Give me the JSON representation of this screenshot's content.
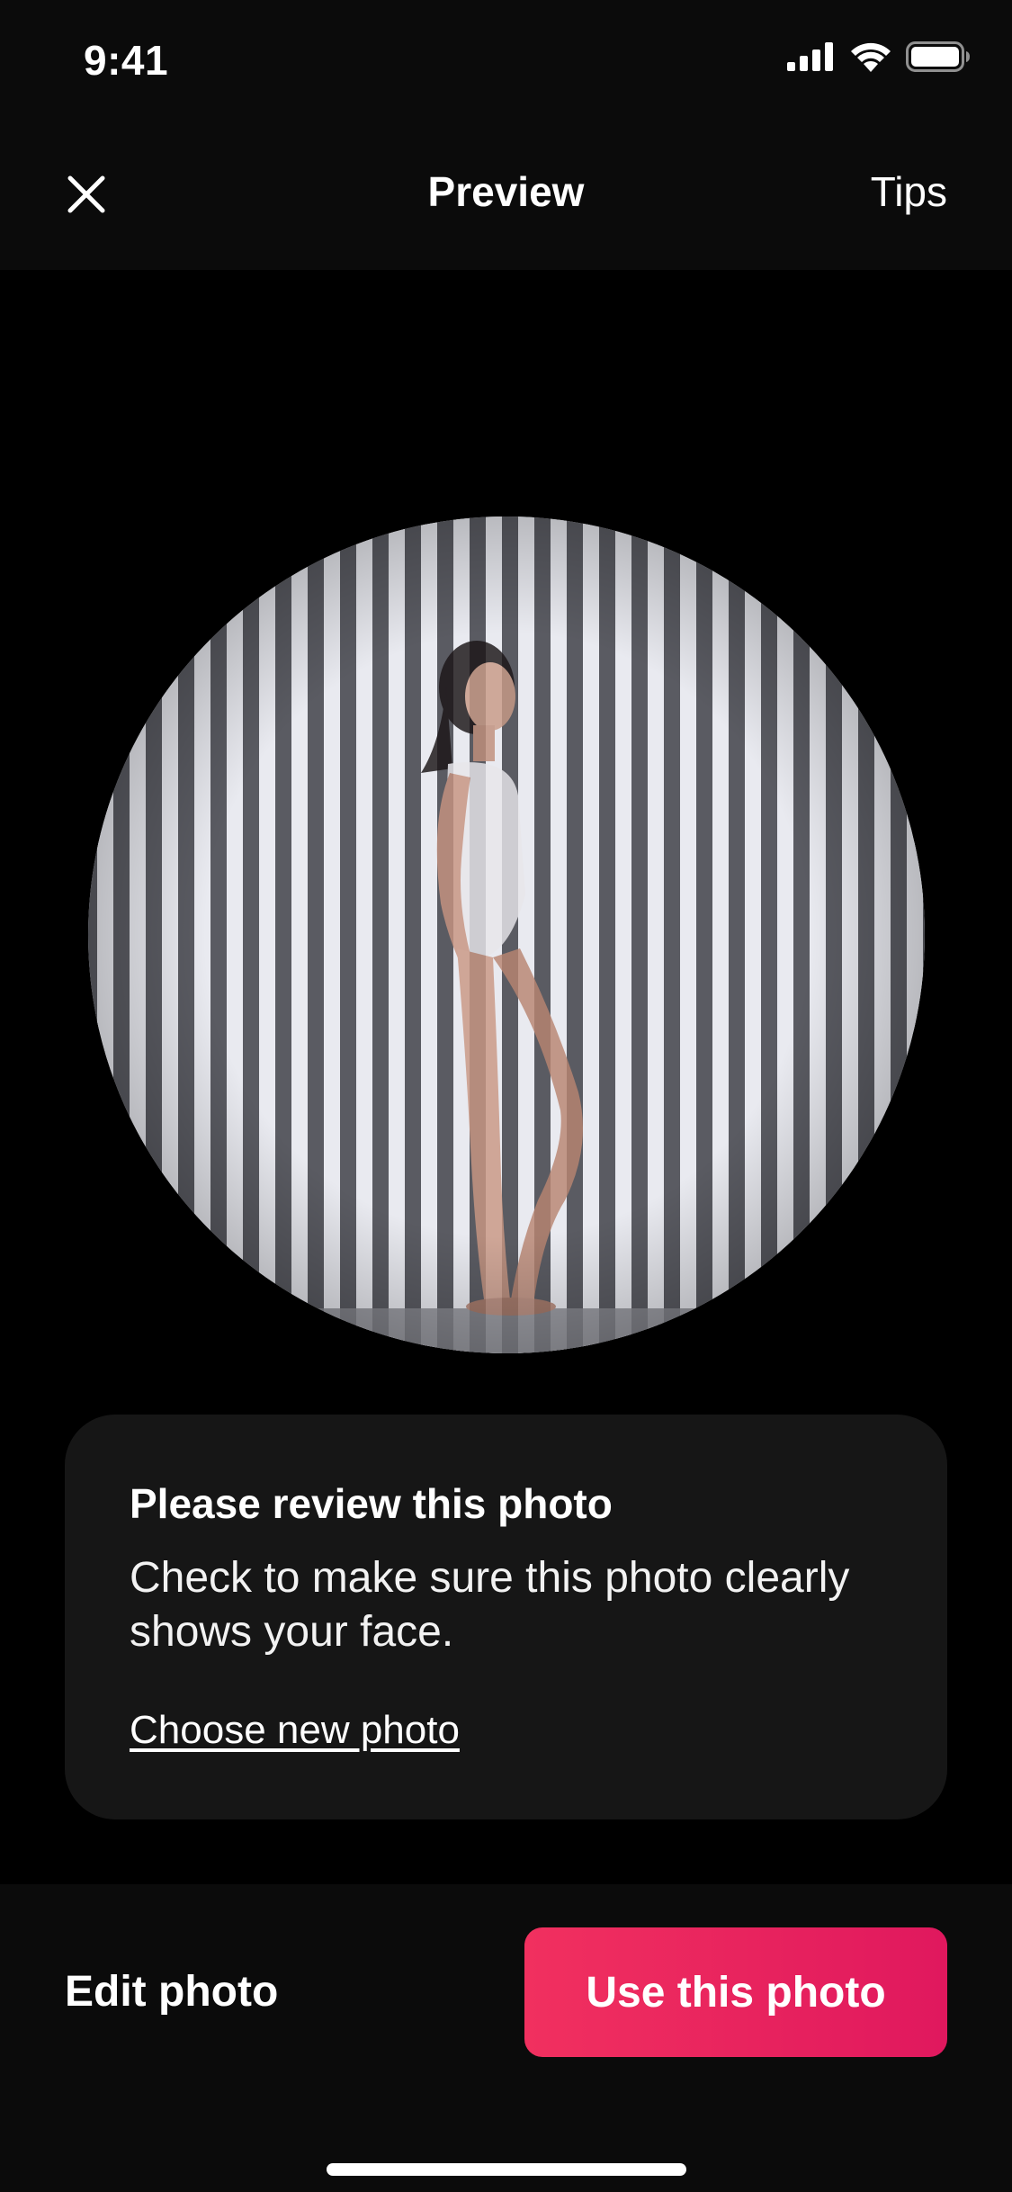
{
  "status_bar": {
    "time": "9:41",
    "icons": [
      "cellular-signal-icon",
      "wifi-icon",
      "battery-icon"
    ]
  },
  "nav": {
    "close_icon": "close-icon",
    "title": "Preview",
    "tips_label": "Tips"
  },
  "photo": {
    "icon": "profile-photo"
  },
  "review_card": {
    "title": "Please review this photo",
    "body": "Check to make sure this photo clearly shows your face.",
    "link_label": "Choose new photo"
  },
  "actions": {
    "edit_label": "Edit photo",
    "use_label": "Use this photo"
  },
  "colors": {
    "background": "#000000",
    "bar_background": "#0b0b0b",
    "card_background": "#161616",
    "primary_start": "#f1305f",
    "primary_end": "#e0185e",
    "text": "#ffffff"
  }
}
